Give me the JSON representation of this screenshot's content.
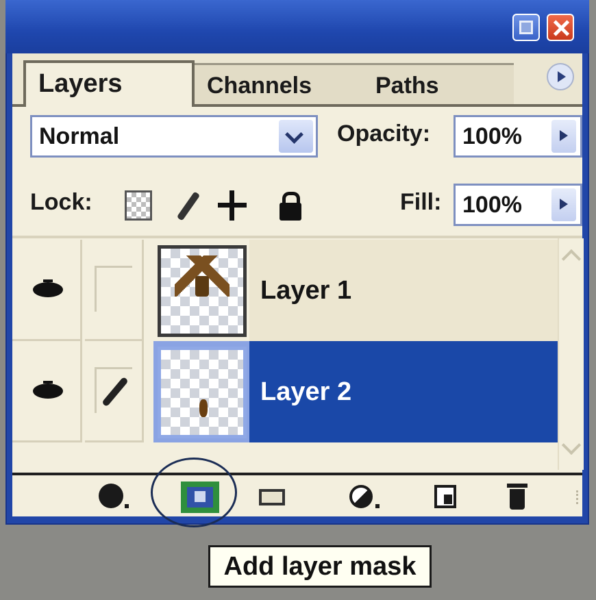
{
  "tabs": [
    {
      "label": "Layers",
      "active": true
    },
    {
      "label": "Channels",
      "active": false
    },
    {
      "label": "Paths",
      "active": false
    }
  ],
  "blend_mode": {
    "selected": "Normal"
  },
  "opacity": {
    "label": "Opacity:",
    "value": "100%"
  },
  "lock": {
    "label": "Lock:",
    "icons": [
      "lock-transparent-icon",
      "lock-image-icon",
      "lock-position-icon",
      "lock-all-icon"
    ]
  },
  "fill": {
    "label": "Fill:",
    "value": "100%"
  },
  "layers": [
    {
      "name": "Layer 1",
      "selected": false
    },
    {
      "name": "Layer 2",
      "selected": true
    }
  ],
  "toolbar_icons": [
    "layer-style-icon",
    "add-layer-mask-icon",
    "new-group-icon",
    "adjustment-layer-icon",
    "new-layer-icon",
    "trash-icon"
  ],
  "tooltip": "Add layer mask",
  "colors": {
    "selection": "#1a48a8",
    "titlebar": "#2146a8",
    "panel": "#f3efde"
  }
}
